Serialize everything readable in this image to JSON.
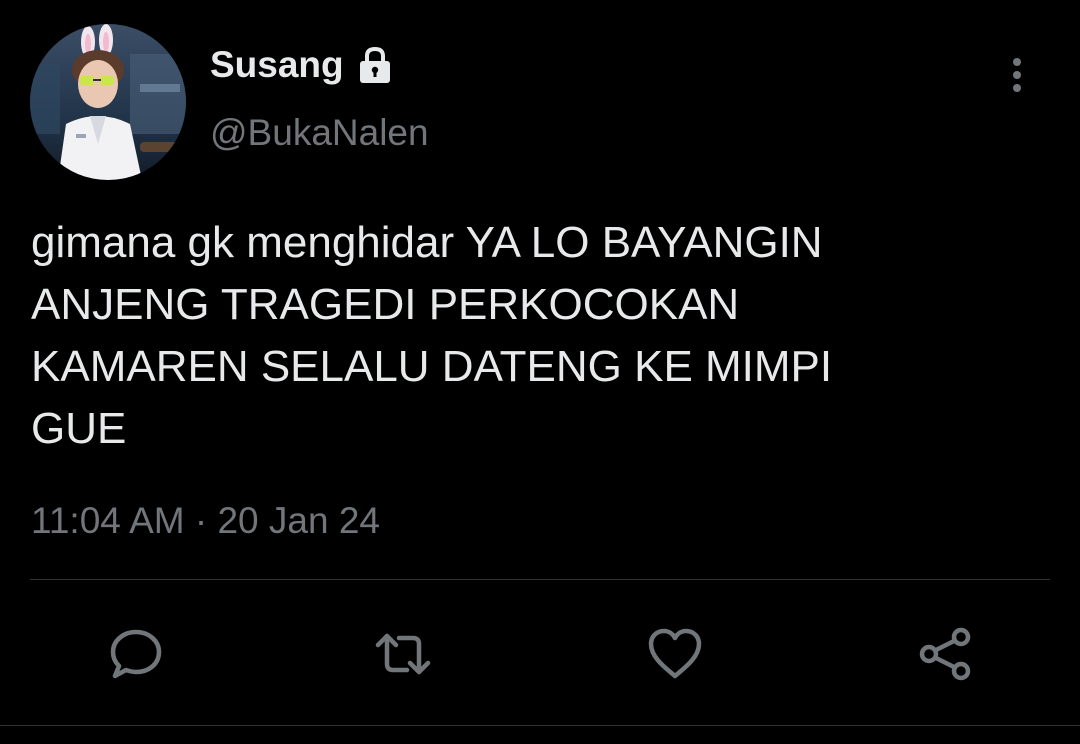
{
  "author": {
    "display_name": "Susang",
    "handle": "@BukaNalen",
    "protected_icon": "lock-icon",
    "avatar": "profile-photo"
  },
  "tweet": {
    "text": "gimana gk menghidar YA LO BAYANGIN\nANJENG TRAGEDI PERKOCOKAN\nKAMAREN SELALU DATENG KE MIMPI\nGUE",
    "timestamp": "11:04 AM · 20 Jan 24"
  },
  "actions": [
    {
      "icon": "reply-icon"
    },
    {
      "icon": "retweet-icon"
    },
    {
      "icon": "like-icon"
    },
    {
      "icon": "share-icon"
    }
  ],
  "menu_icon": "more-vertical-icon",
  "colors": {
    "background": "#000000",
    "primary_text": "#e7e9ea",
    "secondary_text": "#71767b",
    "divider": "#2f3336",
    "icon": "#71767b"
  }
}
